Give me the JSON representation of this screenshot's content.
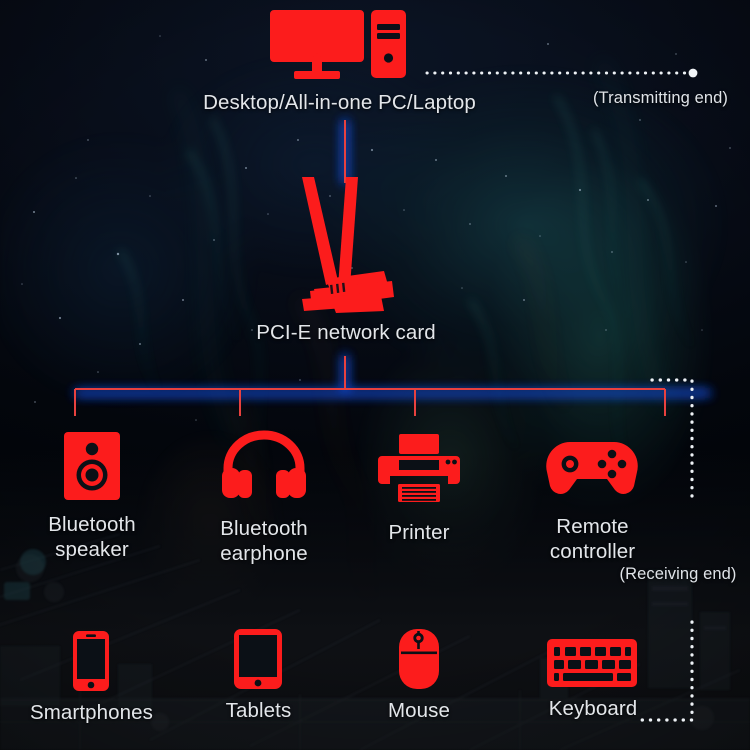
{
  "diagram": {
    "title_alt": "PCI-E wireless network card connection topology",
    "accent_color": "#FC1C1C",
    "label_color": "#E3E6EA",
    "line_color": "#E0403F",
    "glow_color": "#1B4FD8"
  },
  "source": {
    "label": "Desktop/All-in-one PC/Laptop",
    "icon": "desktop-computer-icon",
    "end_note": "(Transmitting end)"
  },
  "hub": {
    "label": "PCI-E network card",
    "icon": "pcie-network-card-icon"
  },
  "receiving_note": "(Receiving end)",
  "devices_row1": [
    {
      "label": "Bluetooth\nspeaker",
      "icon": "bluetooth-speaker-icon"
    },
    {
      "label": "Bluetooth\nearphone",
      "icon": "headphones-icon"
    },
    {
      "label": "Printer",
      "icon": "printer-icon"
    },
    {
      "label": "Remote\ncontroller",
      "icon": "gamepad-icon"
    }
  ],
  "devices_row2": [
    {
      "label": "Smartphones",
      "icon": "smartphone-icon"
    },
    {
      "label": "Tablets",
      "icon": "tablet-icon"
    },
    {
      "label": "Mouse",
      "icon": "mouse-icon"
    },
    {
      "label": "Keyboard",
      "icon": "keyboard-icon"
    }
  ]
}
